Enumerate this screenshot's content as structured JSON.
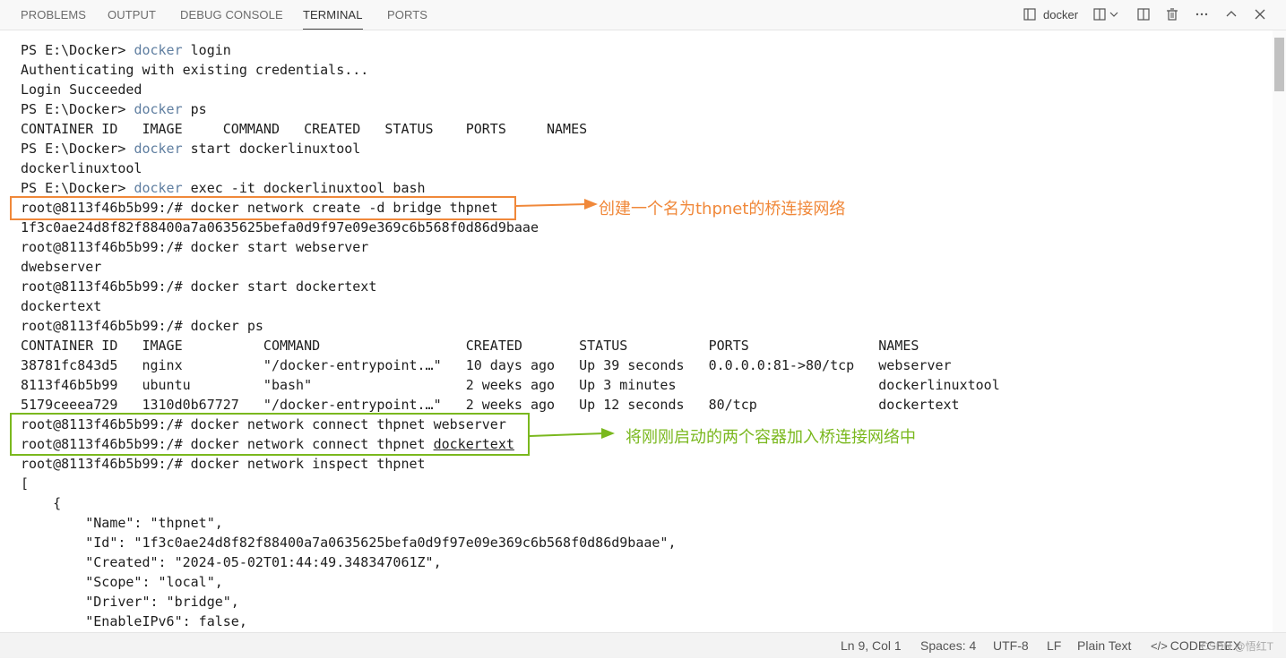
{
  "tabs": [
    "PROBLEMS",
    "OUTPUT",
    "DEBUG CONSOLE",
    "TERMINAL",
    "PORTS"
  ],
  "active_tab": "TERMINAL",
  "terminal": {
    "name": "docker",
    "lines": [
      [
        {
          "t": "PS E:\\Docker> "
        },
        {
          "t": "docker",
          "k": 1
        },
        {
          "t": " login"
        }
      ],
      [
        {
          "t": "Authenticating with existing credentials..."
        }
      ],
      [
        {
          "t": "Login Succeeded"
        }
      ],
      [
        {
          "t": "PS E:\\Docker> "
        },
        {
          "t": "docker",
          "k": 1
        },
        {
          "t": " ps"
        }
      ],
      [
        {
          "t": "CONTAINER ID   IMAGE     COMMAND   CREATED   STATUS    PORTS     NAMES"
        }
      ],
      [
        {
          "t": "PS E:\\Docker> "
        },
        {
          "t": "docker",
          "k": 1
        },
        {
          "t": " start dockerlinuxtool"
        }
      ],
      [
        {
          "t": "dockerlinuxtool"
        }
      ],
      [
        {
          "t": "PS E:\\Docker> "
        },
        {
          "t": "docker",
          "k": 1
        },
        {
          "t": " exec -it dockerlinuxtool bash"
        }
      ],
      [
        {
          "t": "root@8113f46b5b99:/# docker network create -d bridge thpnet"
        }
      ],
      [
        {
          "t": "1f3c0ae24d8f82f88400a7a0635625befa0d9f97e09e369c6b568f0d86d9baae"
        }
      ],
      [
        {
          "t": "root@8113f46b5b99:/# docker start webserver"
        }
      ],
      [
        {
          "t": "dwebserver"
        }
      ],
      [
        {
          "t": "root@8113f46b5b99:/# docker start dockertext"
        }
      ],
      [
        {
          "t": "dockertext"
        }
      ],
      [
        {
          "t": "root@8113f46b5b99:/# docker ps"
        }
      ],
      [
        {
          "t": "CONTAINER ID   IMAGE          COMMAND                  CREATED       STATUS          PORTS                NAMES"
        }
      ],
      [
        {
          "t": "38781fc843d5   nginx          \"/docker-entrypoint.…\"   10 days ago   Up 39 seconds   0.0.0.0:81->80/tcp   webserver"
        }
      ],
      [
        {
          "t": "8113f46b5b99   ubuntu         \"bash\"                   2 weeks ago   Up 3 minutes                         dockerlinuxtool"
        }
      ],
      [
        {
          "t": "5179ceeea729   1310d0b67727   \"/docker-entrypoint.…\"   2 weeks ago   Up 12 seconds   80/tcp               dockertext"
        }
      ],
      [
        {
          "t": "root@8113f46b5b99:/# docker network connect thpnet webserver"
        }
      ],
      [
        {
          "t": "root@8113f46b5b99:/# docker network connect thpnet "
        },
        {
          "t": "dockertext",
          "u": 1
        }
      ],
      [
        {
          "t": "root@8113f46b5b99:/# docker network inspect thpnet"
        }
      ],
      [
        {
          "t": "["
        }
      ],
      [
        {
          "t": "    {"
        }
      ],
      [
        {
          "t": "        \"Name\": \"thpnet\","
        }
      ],
      [
        {
          "t": "        \"Id\": \"1f3c0ae24d8f82f88400a7a0635625befa0d9f97e09e369c6b568f0d86d9baae\","
        }
      ],
      [
        {
          "t": "        \"Created\": \"2024-05-02T01:44:49.348347061Z\","
        }
      ],
      [
        {
          "t": "        \"Scope\": \"local\","
        }
      ],
      [
        {
          "t": "        \"Driver\": \"bridge\","
        }
      ],
      [
        {
          "t": "        \"EnableIPv6\": false,"
        }
      ]
    ]
  },
  "annotations": [
    {
      "text": "创建一个名为thpnet的桥连接网络",
      "color": "#f0883a"
    },
    {
      "text": "将刚刚启动的两个容器加入桥连接网络中",
      "color": "#7ab81e"
    }
  ],
  "status_bar": {
    "position": "Ln 9, Col 1",
    "spaces": "Spaces: 4",
    "encoding": "UTF-8",
    "eol": "LF",
    "language": "Plain Text",
    "brand": "CODEGEEX",
    "watermark": "CSDN @悟红T"
  },
  "icons": [
    "terminal-icon",
    "split-terminal-icon",
    "chevron-down-icon",
    "maximize-panel-icon",
    "trash-icon",
    "more-icon",
    "chevron-up-icon",
    "close-icon",
    "codegeex-icon"
  ]
}
